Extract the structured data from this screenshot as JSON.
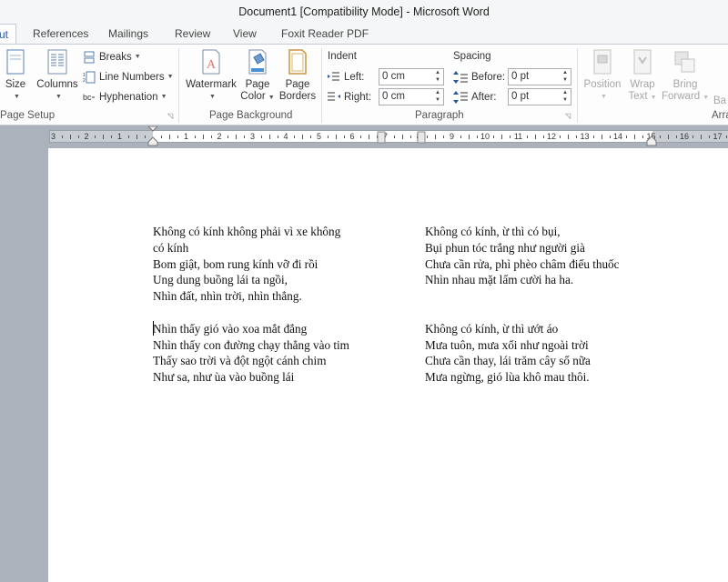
{
  "window": {
    "title": "Document1 [Compatibility Mode]  -  Microsoft Word"
  },
  "tabs": [
    {
      "label": "ut",
      "active": true
    },
    {
      "label": "References"
    },
    {
      "label": "Mailings"
    },
    {
      "label": "Review"
    },
    {
      "label": "View"
    },
    {
      "label": "Foxit Reader PDF"
    }
  ],
  "ribbon": {
    "page_setup": {
      "label": "Page Setup",
      "size": "Size",
      "columns": "Columns",
      "breaks": "Breaks",
      "line_numbers": "Line Numbers",
      "hyphenation": "Hyphenation"
    },
    "page_background": {
      "label": "Page Background",
      "watermark": "Watermark",
      "page_color_1": "Page",
      "page_color_2": "Color",
      "page_borders_1": "Page",
      "page_borders_2": "Borders"
    },
    "paragraph": {
      "label": "Paragraph",
      "indent": "Indent",
      "left_label": "Left:",
      "left_value": "0 cm",
      "right_label": "Right:",
      "right_value": "0 cm",
      "spacing": "Spacing",
      "before_label": "Before:",
      "before_value": "0 pt",
      "after_label": "After:",
      "after_value": "0 pt"
    },
    "arrange": {
      "label": "Arra",
      "position": "Position",
      "wrap_1": "Wrap",
      "wrap_2": "Text",
      "bring_1": "Bring",
      "bring_2": "Forward",
      "send_1": "Ba"
    }
  },
  "ruler": {
    "left_numbers": [
      "3",
      "2",
      "1"
    ],
    "right_numbers": [
      "1",
      "2",
      "3",
      "4",
      "5",
      "6",
      "7",
      "8",
      "9",
      "10",
      "11",
      "12",
      "13",
      "14",
      "15",
      "16",
      "17"
    ]
  },
  "document": {
    "left_column": [
      [
        "Không có kính không phải vì xe không",
        "có kính",
        "Bom giật, bom rung kính vỡ đi rồi",
        "Ung dung buồng lái ta ngồi,",
        "Nhìn đất, nhìn trời, nhìn thẳng."
      ],
      [
        "Nhìn thấy gió vào xoa mắt đắng",
        "Nhìn thấy con đường chạy thẳng vào tim",
        "Thấy sao trời và đột ngột cánh chim",
        "Như sa, như ùa vào buồng lái"
      ]
    ],
    "right_column": [
      [
        "Không có kính, ừ thì có bụi,",
        "Bụi phun tóc trắng như người già",
        "Chưa cần rửa, phì phèo châm điếu thuốc",
        "Nhìn nhau mặt lấm cười ha ha."
      ],
      [
        "Không có kính, ừ thì ướt áo",
        "Mưa tuôn, mưa xối như ngoài trời",
        "Chưa cần thay, lái trăm cây số nữa",
        "Mưa ngừng, gió lùa khô mau thôi."
      ]
    ]
  }
}
